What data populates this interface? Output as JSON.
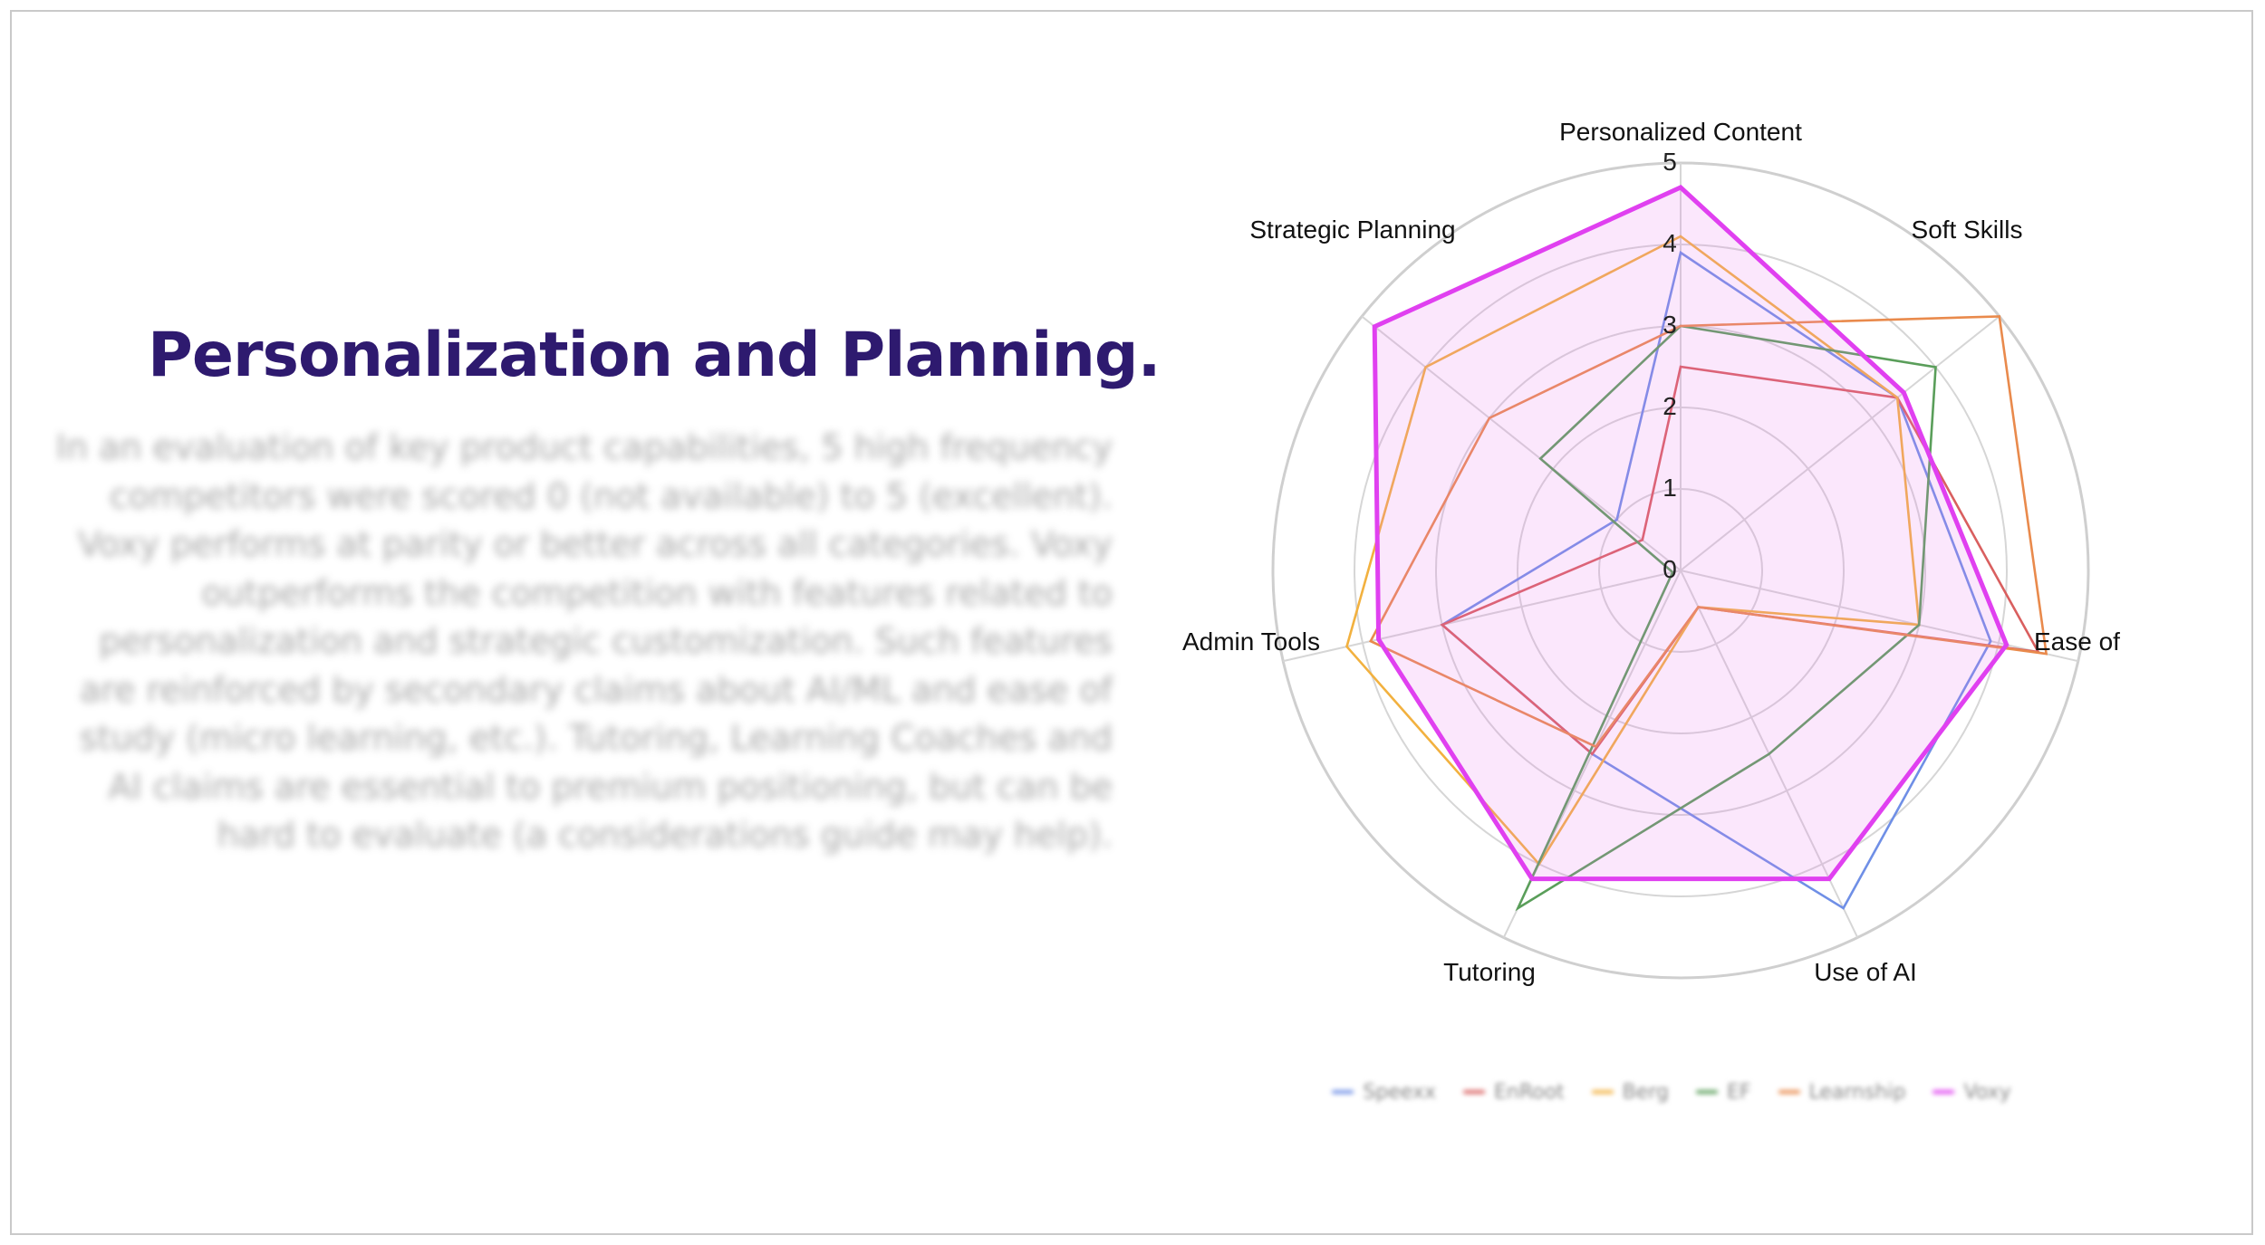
{
  "slide": {
    "title": "Personalization and Planning.",
    "body": "In an evaluation of key product capabilities, 5 high frequency competitors were scored 0 (not available) to 5 (excellent). Voxy performs at parity or better across all categories. Voxy outperforms the competition with features related to personalization and strategic customization. Such features are reinforced by secondary claims about AI/ML and ease of study (micro learning, etc.). Tutoring, Learning Coaches and AI claims are essential to premium positioning, but can be hard to evaluate (a considerations guide may help)."
  },
  "chart_data": {
    "type": "radar",
    "axes": [
      "Personalized Content",
      "Soft Skills",
      "Ease of Study",
      "Use of AI",
      "Tutoring",
      "Admin Tools",
      "Strategic Planning"
    ],
    "r_ticks": [
      "0",
      "1",
      "2",
      "3",
      "4",
      "5"
    ],
    "r_range": [
      0,
      5
    ],
    "grid": true,
    "legend_position": "bottom",
    "series": [
      {
        "name": "Speexx",
        "color": "#6f8fe6",
        "values": [
          3.9,
          3.4,
          3.9,
          4.6,
          2.5,
          3.0,
          1.0
        ]
      },
      {
        "name": "EnRoot",
        "color": "#d95f5f",
        "values": [
          2.5,
          3.4,
          4.5,
          0.5,
          2.5,
          3.0,
          0.6
        ]
      },
      {
        "name": "Berg",
        "color": "#f2b13f",
        "values": [
          4.1,
          3.4,
          3.0,
          0.5,
          4.0,
          4.2,
          4.0
        ]
      },
      {
        "name": "EF",
        "color": "#5a9e5a",
        "values": [
          3.0,
          4.0,
          3.0,
          2.5,
          4.6,
          0.1,
          2.2
        ]
      },
      {
        "name": "Learnship",
        "color": "#e98a4c",
        "values": [
          3.0,
          5.0,
          4.6,
          0.5,
          2.4,
          3.9,
          3.0
        ]
      },
      {
        "name": "Voxy",
        "color": "#e040f0",
        "values": [
          4.7,
          3.5,
          4.1,
          4.2,
          4.2,
          3.8,
          4.8
        ]
      }
    ]
  }
}
